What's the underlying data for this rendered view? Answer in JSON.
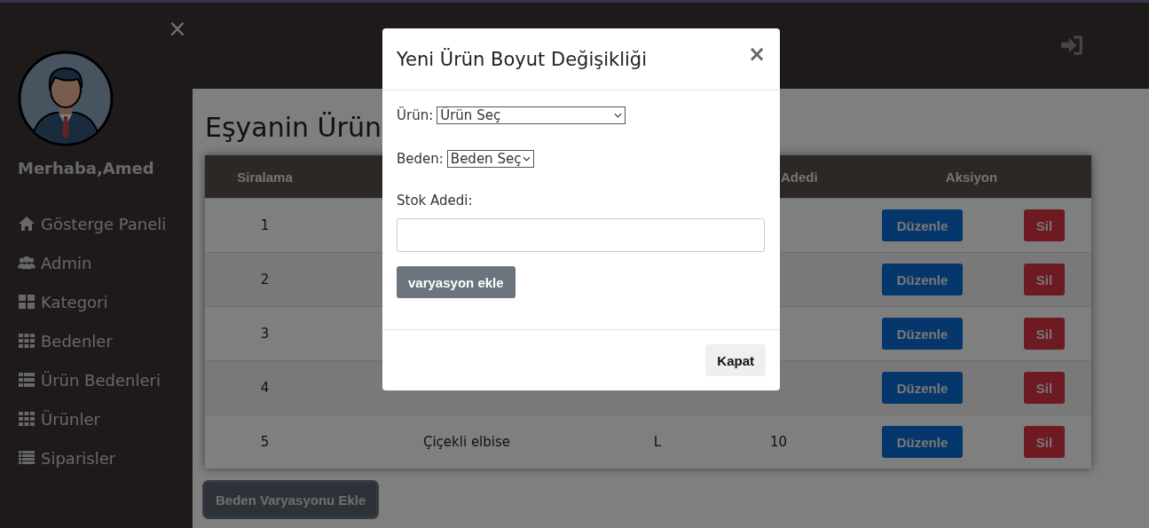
{
  "sidebar": {
    "close": "×",
    "greeting": "Merhaba,Amed",
    "items": [
      {
        "label": "Gösterge Paneli"
      },
      {
        "label": "Admin"
      },
      {
        "label": "Kategori"
      },
      {
        "label": "Bedenler"
      },
      {
        "label": "Ürün Bedenleri"
      },
      {
        "label": "Ürünler"
      },
      {
        "label": "Siparisler"
      }
    ]
  },
  "page": {
    "title": "Eşyanin Ürün"
  },
  "table": {
    "header": {
      "column_1": "Siralama",
      "column_4": "Adedi",
      "column_5": "Aksiyon"
    },
    "rows": [
      {
        "column_1": "1",
        "edit": "Düzenle",
        "delete": "Sil"
      },
      {
        "column_1": "2",
        "edit": "Düzenle",
        "delete": "Sil"
      },
      {
        "column_1": "3",
        "edit": "Düzenle",
        "delete": "Sil"
      },
      {
        "column_1": "4",
        "edit": "Düzenle",
        "delete": "Sil"
      },
      {
        "column_1": "5",
        "column_2": "Çiçekli elbise",
        "column_3": "L",
        "column_4": "10",
        "edit": "Düzenle",
        "delete": "Sil"
      }
    ]
  },
  "add_button": "Beden Varyasyonu Ekle",
  "modal": {
    "title": "Yeni Ürün Boyut Değişikliği",
    "close": "×",
    "product": {
      "label": "Ürün:",
      "value": "Ürün Seç"
    },
    "size": {
      "label": "Beden:",
      "value": "Beden Seç"
    },
    "stock": {
      "label": "Stok Adedi:"
    },
    "submit": "varyasyon ekle",
    "footer_button": "Kapat"
  }
}
